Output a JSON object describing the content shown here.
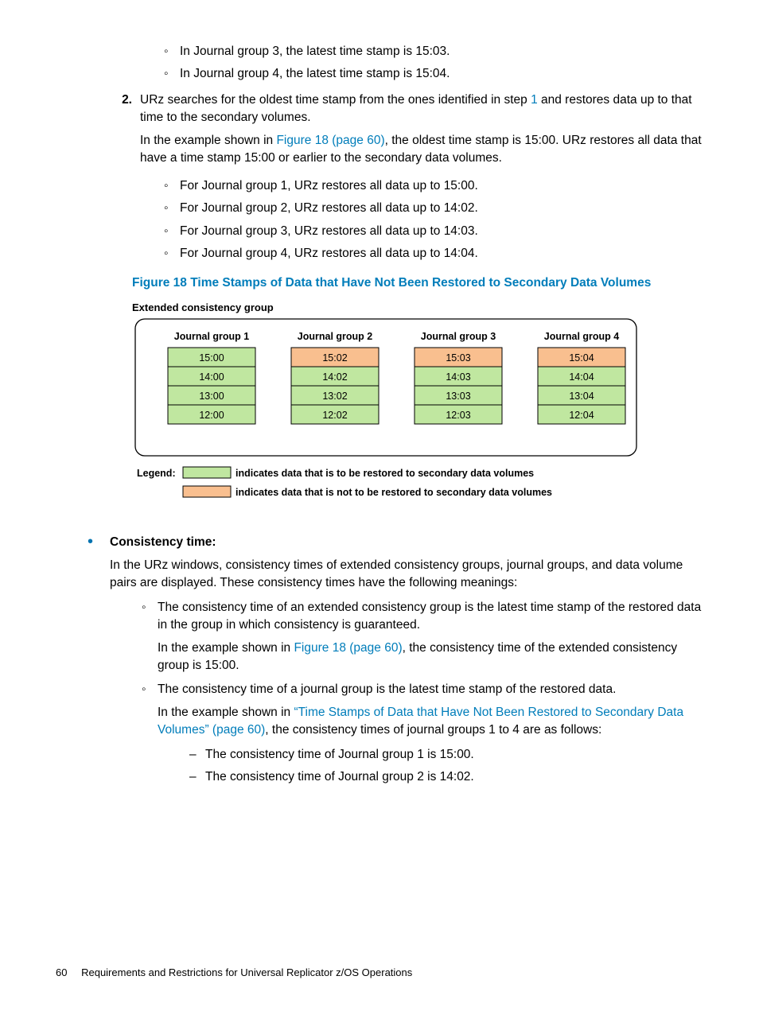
{
  "top_sublist": [
    "In Journal group 3, the latest time stamp is 15:03.",
    "In Journal group 4, the latest time stamp is 15:04."
  ],
  "step2_marker": "2.",
  "step2_text_a": "URz searches for the oldest time stamp from the ones identified in step ",
  "step2_link1": "1",
  "step2_text_b": " and restores data up to that time to the secondary volumes.",
  "step2_para2_a": "In the example shown in ",
  "step2_link2": "Figure 18 (page 60)",
  "step2_para2_b": ", the oldest time stamp is 15:00. URz restores all data that have a time stamp 15:00 or earlier to the secondary data volumes.",
  "step2_sublist": [
    "For Journal group 1, URz restores all data up to 15:00.",
    "For Journal group 2, URz restores all data up to 14:02.",
    "For Journal group 3, URz restores all data up to 14:03.",
    "For Journal group 4, URz restores all data up to 14:04."
  ],
  "figure_caption": "Figure 18 Time Stamps of Data that Have Not Been Restored to Secondary Data Volumes",
  "chart_data": {
    "type": "table",
    "title": "Extended consistency group",
    "columns": [
      "Journal group 1",
      "Journal group 2",
      "Journal group 3",
      "Journal group 4"
    ],
    "rows": [
      [
        "15:00",
        "15:02",
        "15:03",
        "15:04"
      ],
      [
        "14:00",
        "14:02",
        "14:03",
        "14:04"
      ],
      [
        "13:00",
        "13:02",
        "13:03",
        "13:04"
      ],
      [
        "12:00",
        "12:02",
        "12:03",
        "12:04"
      ]
    ],
    "restore_green": [
      [
        0,
        0
      ],
      [
        0,
        1
      ],
      [
        0,
        2
      ],
      [
        0,
        3
      ],
      [
        1,
        1
      ],
      [
        1,
        2
      ],
      [
        1,
        3
      ],
      [
        2,
        1
      ],
      [
        2,
        2
      ],
      [
        2,
        3
      ],
      [
        3,
        1
      ],
      [
        3,
        2
      ],
      [
        3,
        3
      ]
    ],
    "legend": {
      "label": "Legend:",
      "green": "indicates data that is to be restored to secondary data volumes",
      "orange": "indicates data that is not to be restored to secondary data volumes"
    }
  },
  "ct_heading": "Consistency time:",
  "ct_para": "In the URz windows, consistency times of extended consistency groups, journal groups, and data volume pairs are displayed. These consistency times have the following meanings:",
  "ct_item1_text": "The consistency time of an extended consistency group is the latest time stamp of the restored data in the group in which consistency is guaranteed.",
  "ct_item1_p_a": "In the example shown in ",
  "ct_item1_link": "Figure 18 (page 60)",
  "ct_item1_p_b": ", the consistency time of the extended consistency group is 15:00.",
  "ct_item2_text": "The consistency time of a journal group is the latest time stamp of the restored data.",
  "ct_item2_p_a": "In the example shown in ",
  "ct_item2_link": "“Time Stamps of Data that Have Not Been Restored to Secondary Data Volumes” (page 60)",
  "ct_item2_p_b": ", the consistency times of journal groups 1 to 4 are as follows:",
  "ct_item2_dashes": [
    "The consistency time of Journal group 1 is 15:00.",
    "The consistency time of Journal group 2 is 14:02."
  ],
  "footer_page": "60",
  "footer_text": "Requirements and Restrictions for Universal Replicator z/OS Operations"
}
